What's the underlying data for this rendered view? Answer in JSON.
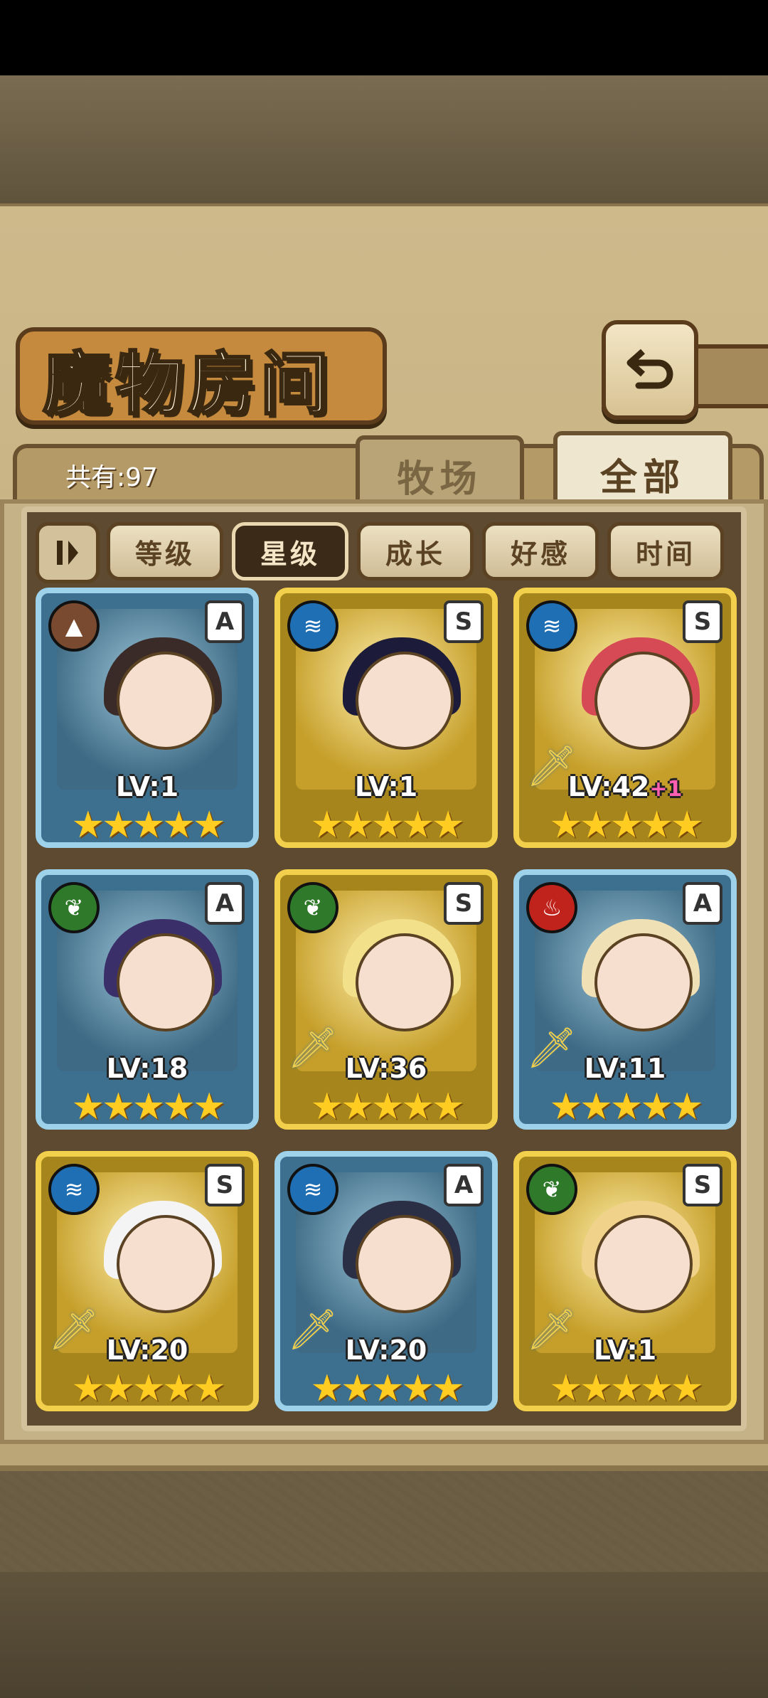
{
  "page": {
    "title": "魔物房间",
    "back_icon": "back-arrow-icon"
  },
  "tabs": {
    "total": "共有:97",
    "farm": "牧场",
    "all": "全部"
  },
  "sort": {
    "toggle_icon": "sort-order-icon",
    "buttons": [
      "等级",
      "星级",
      "成长",
      "好感",
      "时间"
    ],
    "active": "星级"
  },
  "monsters": [
    {
      "rank": "A",
      "element": "earth",
      "level": "LV:1",
      "bonus": "",
      "stars": "★★★★★",
      "weapon": false
    },
    {
      "rank": "S",
      "element": "water",
      "level": "LV:1",
      "bonus": "",
      "stars": "★★★★★",
      "weapon": false
    },
    {
      "rank": "S",
      "element": "water",
      "level": "LV:42",
      "bonus": "+1",
      "stars": "★★★★★",
      "weapon": true
    },
    {
      "rank": "A",
      "element": "wood",
      "level": "LV:18",
      "bonus": "",
      "stars": "★★★★★",
      "weapon": false
    },
    {
      "rank": "S",
      "element": "wood",
      "level": "LV:36",
      "bonus": "",
      "stars": "★★★★★",
      "weapon": true
    },
    {
      "rank": "A",
      "element": "fire",
      "level": "LV:11",
      "bonus": "",
      "stars": "★★★★★",
      "weapon": true
    },
    {
      "rank": "S",
      "element": "water",
      "level": "LV:20",
      "bonus": "",
      "stars": "★★★★★",
      "weapon": true
    },
    {
      "rank": "A",
      "element": "water",
      "level": "LV:20",
      "bonus": "",
      "stars": "★★★★★",
      "weapon": true
    },
    {
      "rank": "S",
      "element": "wood",
      "level": "LV:1",
      "bonus": "",
      "stars": "★★★★★",
      "weapon": true
    }
  ],
  "colors": {
    "earth": "#7a4a30",
    "water": "#1f6fb5",
    "wood": "#2f7a2a",
    "fire": "#c0231b"
  }
}
